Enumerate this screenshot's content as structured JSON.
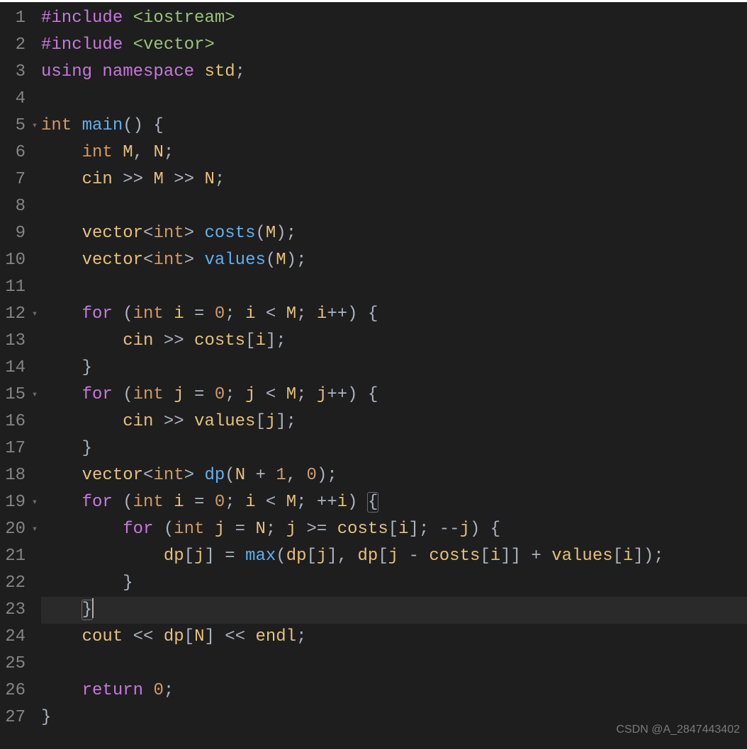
{
  "watermark": "CSDN @A_2847443402",
  "gutter": {
    "lines": [
      "1",
      "2",
      "3",
      "4",
      "5",
      "6",
      "7",
      "8",
      "9",
      "10",
      "11",
      "12",
      "13",
      "14",
      "15",
      "16",
      "17",
      "18",
      "19",
      "20",
      "21",
      "22",
      "23",
      "24",
      "25",
      "26",
      "27"
    ],
    "fold_markers": {
      "5": "▾",
      "12": "▾",
      "15": "▾",
      "19": "▾",
      "20": "▾"
    }
  },
  "highlight_line": 23,
  "code": {
    "l1": [
      [
        "c-mag",
        "#include "
      ],
      [
        "c-grn",
        "<iostream>"
      ]
    ],
    "l2": [
      [
        "c-mag",
        "#include "
      ],
      [
        "c-grn",
        "<vector>"
      ]
    ],
    "l3": [
      [
        "c-mag",
        "using "
      ],
      [
        "c-mag",
        "namespace "
      ],
      [
        "c-yel",
        "std"
      ],
      [
        "c-gry",
        ";"
      ]
    ],
    "l4": [
      [
        "c-gry",
        ""
      ]
    ],
    "l5": [
      [
        "c-orn",
        "int "
      ],
      [
        "c-blu",
        "main"
      ],
      [
        "c-gry",
        "() {"
      ]
    ],
    "l6": [
      [
        "c-gry",
        "    "
      ],
      [
        "c-orn",
        "int "
      ],
      [
        "c-yel",
        "M"
      ],
      [
        "c-gry",
        ", "
      ],
      [
        "c-yel",
        "N"
      ],
      [
        "c-gry",
        ";"
      ]
    ],
    "l7": [
      [
        "c-gry",
        "    "
      ],
      [
        "c-yel",
        "cin "
      ],
      [
        "c-gry",
        ">> "
      ],
      [
        "c-yel",
        "M "
      ],
      [
        "c-gry",
        ">> "
      ],
      [
        "c-yel",
        "N"
      ],
      [
        "c-gry",
        ";"
      ]
    ],
    "l8": [
      [
        "c-gry",
        ""
      ]
    ],
    "l9": [
      [
        "c-gry",
        "    "
      ],
      [
        "c-yel",
        "vector"
      ],
      [
        "c-gry",
        "<"
      ],
      [
        "c-orn",
        "int"
      ],
      [
        "c-gry",
        "> "
      ],
      [
        "c-blu",
        "costs"
      ],
      [
        "c-gry",
        "("
      ],
      [
        "c-yel",
        "M"
      ],
      [
        "c-gry",
        ");"
      ]
    ],
    "l10": [
      [
        "c-gry",
        "    "
      ],
      [
        "c-yel",
        "vector"
      ],
      [
        "c-gry",
        "<"
      ],
      [
        "c-orn",
        "int"
      ],
      [
        "c-gry",
        "> "
      ],
      [
        "c-blu",
        "values"
      ],
      [
        "c-gry",
        "("
      ],
      [
        "c-yel",
        "M"
      ],
      [
        "c-gry",
        ");"
      ]
    ],
    "l11": [
      [
        "c-gry",
        ""
      ]
    ],
    "l12": [
      [
        "c-gry",
        "    "
      ],
      [
        "c-mag",
        "for "
      ],
      [
        "c-gry",
        "("
      ],
      [
        "c-orn",
        "int "
      ],
      [
        "c-yel",
        "i "
      ],
      [
        "c-gry",
        "= "
      ],
      [
        "c-orn",
        "0"
      ],
      [
        "c-gry",
        "; "
      ],
      [
        "c-yel",
        "i "
      ],
      [
        "c-gry",
        "< "
      ],
      [
        "c-yel",
        "M"
      ],
      [
        "c-gry",
        "; "
      ],
      [
        "c-yel",
        "i"
      ],
      [
        "c-gry",
        "++) {"
      ]
    ],
    "l13": [
      [
        "c-gry",
        "        "
      ],
      [
        "c-yel",
        "cin "
      ],
      [
        "c-gry",
        ">> "
      ],
      [
        "c-yel",
        "costs"
      ],
      [
        "c-gry",
        "["
      ],
      [
        "c-yel",
        "i"
      ],
      [
        "c-gry",
        "];"
      ]
    ],
    "l14": [
      [
        "c-gry",
        "    }"
      ]
    ],
    "l15": [
      [
        "c-gry",
        "    "
      ],
      [
        "c-mag",
        "for "
      ],
      [
        "c-gry",
        "("
      ],
      [
        "c-orn",
        "int "
      ],
      [
        "c-yel",
        "j "
      ],
      [
        "c-gry",
        "= "
      ],
      [
        "c-orn",
        "0"
      ],
      [
        "c-gry",
        "; "
      ],
      [
        "c-yel",
        "j "
      ],
      [
        "c-gry",
        "< "
      ],
      [
        "c-yel",
        "M"
      ],
      [
        "c-gry",
        "; "
      ],
      [
        "c-yel",
        "j"
      ],
      [
        "c-gry",
        "++) {"
      ]
    ],
    "l16": [
      [
        "c-gry",
        "        "
      ],
      [
        "c-yel",
        "cin "
      ],
      [
        "c-gry",
        ">> "
      ],
      [
        "c-yel",
        "values"
      ],
      [
        "c-gry",
        "["
      ],
      [
        "c-yel",
        "j"
      ],
      [
        "c-gry",
        "];"
      ]
    ],
    "l17": [
      [
        "c-gry",
        "    }"
      ]
    ],
    "l18": [
      [
        "c-gry",
        "    "
      ],
      [
        "c-yel",
        "vector"
      ],
      [
        "c-gry",
        "<"
      ],
      [
        "c-orn",
        "int"
      ],
      [
        "c-gry",
        "> "
      ],
      [
        "c-blu",
        "dp"
      ],
      [
        "c-gry",
        "("
      ],
      [
        "c-yel",
        "N "
      ],
      [
        "c-gry",
        "+ "
      ],
      [
        "c-orn",
        "1"
      ],
      [
        "c-gry",
        ", "
      ],
      [
        "c-orn",
        "0"
      ],
      [
        "c-gry",
        ");"
      ]
    ],
    "l19": [
      [
        "c-gry",
        "    "
      ],
      [
        "c-mag",
        "for "
      ],
      [
        "c-gry",
        "("
      ],
      [
        "c-orn",
        "int "
      ],
      [
        "c-yel",
        "i "
      ],
      [
        "c-gry",
        "= "
      ],
      [
        "c-orn",
        "0"
      ],
      [
        "c-gry",
        "; "
      ],
      [
        "c-yel",
        "i "
      ],
      [
        "c-gry",
        "< "
      ],
      [
        "c-yel",
        "M"
      ],
      [
        "c-gry",
        "; ++"
      ],
      [
        "c-yel",
        "i"
      ],
      [
        "c-gry",
        ") "
      ],
      [
        "bracket",
        "{"
      ]
    ],
    "l20": [
      [
        "c-gry",
        "        "
      ],
      [
        "c-mag",
        "for "
      ],
      [
        "c-gry",
        "("
      ],
      [
        "c-orn",
        "int "
      ],
      [
        "c-yel",
        "j "
      ],
      [
        "c-gry",
        "= "
      ],
      [
        "c-yel",
        "N"
      ],
      [
        "c-gry",
        "; "
      ],
      [
        "c-yel",
        "j "
      ],
      [
        "c-gry",
        ">= "
      ],
      [
        "c-yel",
        "costs"
      ],
      [
        "c-gry",
        "["
      ],
      [
        "c-yel",
        "i"
      ],
      [
        "c-gry",
        "]; --"
      ],
      [
        "c-yel",
        "j"
      ],
      [
        "c-gry",
        ") {"
      ]
    ],
    "l21": [
      [
        "c-gry",
        "            "
      ],
      [
        "c-yel",
        "dp"
      ],
      [
        "c-gry",
        "["
      ],
      [
        "c-yel",
        "j"
      ],
      [
        "c-gry",
        "] = "
      ],
      [
        "c-blu",
        "max"
      ],
      [
        "c-gry",
        "("
      ],
      [
        "c-yel",
        "dp"
      ],
      [
        "c-gry",
        "["
      ],
      [
        "c-yel",
        "j"
      ],
      [
        "c-gry",
        "], "
      ],
      [
        "c-yel",
        "dp"
      ],
      [
        "c-gry",
        "["
      ],
      [
        "c-yel",
        "j "
      ],
      [
        "c-gry",
        "- "
      ],
      [
        "c-yel",
        "costs"
      ],
      [
        "c-gry",
        "["
      ],
      [
        "c-yel",
        "i"
      ],
      [
        "c-gry",
        "]] + "
      ],
      [
        "c-yel",
        "values"
      ],
      [
        "c-gry",
        "["
      ],
      [
        "c-yel",
        "i"
      ],
      [
        "c-gry",
        "]);"
      ]
    ],
    "l22": [
      [
        "c-gry",
        "        }"
      ]
    ],
    "l23": [
      [
        "c-gry",
        "    "
      ],
      [
        "bracket",
        "}"
      ],
      [
        "cursor",
        ""
      ]
    ],
    "l24": [
      [
        "c-gry",
        "    "
      ],
      [
        "c-yel",
        "cout "
      ],
      [
        "c-gry",
        "<< "
      ],
      [
        "c-yel",
        "dp"
      ],
      [
        "c-gry",
        "["
      ],
      [
        "c-yel",
        "N"
      ],
      [
        "c-gry",
        "] << "
      ],
      [
        "c-yel",
        "endl"
      ],
      [
        "c-gry",
        ";"
      ]
    ],
    "l25": [
      [
        "c-gry",
        ""
      ]
    ],
    "l26": [
      [
        "c-gry",
        "    "
      ],
      [
        "c-mag",
        "return "
      ],
      [
        "c-orn",
        "0"
      ],
      [
        "c-gry",
        ";"
      ]
    ],
    "l27": [
      [
        "c-gry",
        "}"
      ]
    ]
  }
}
